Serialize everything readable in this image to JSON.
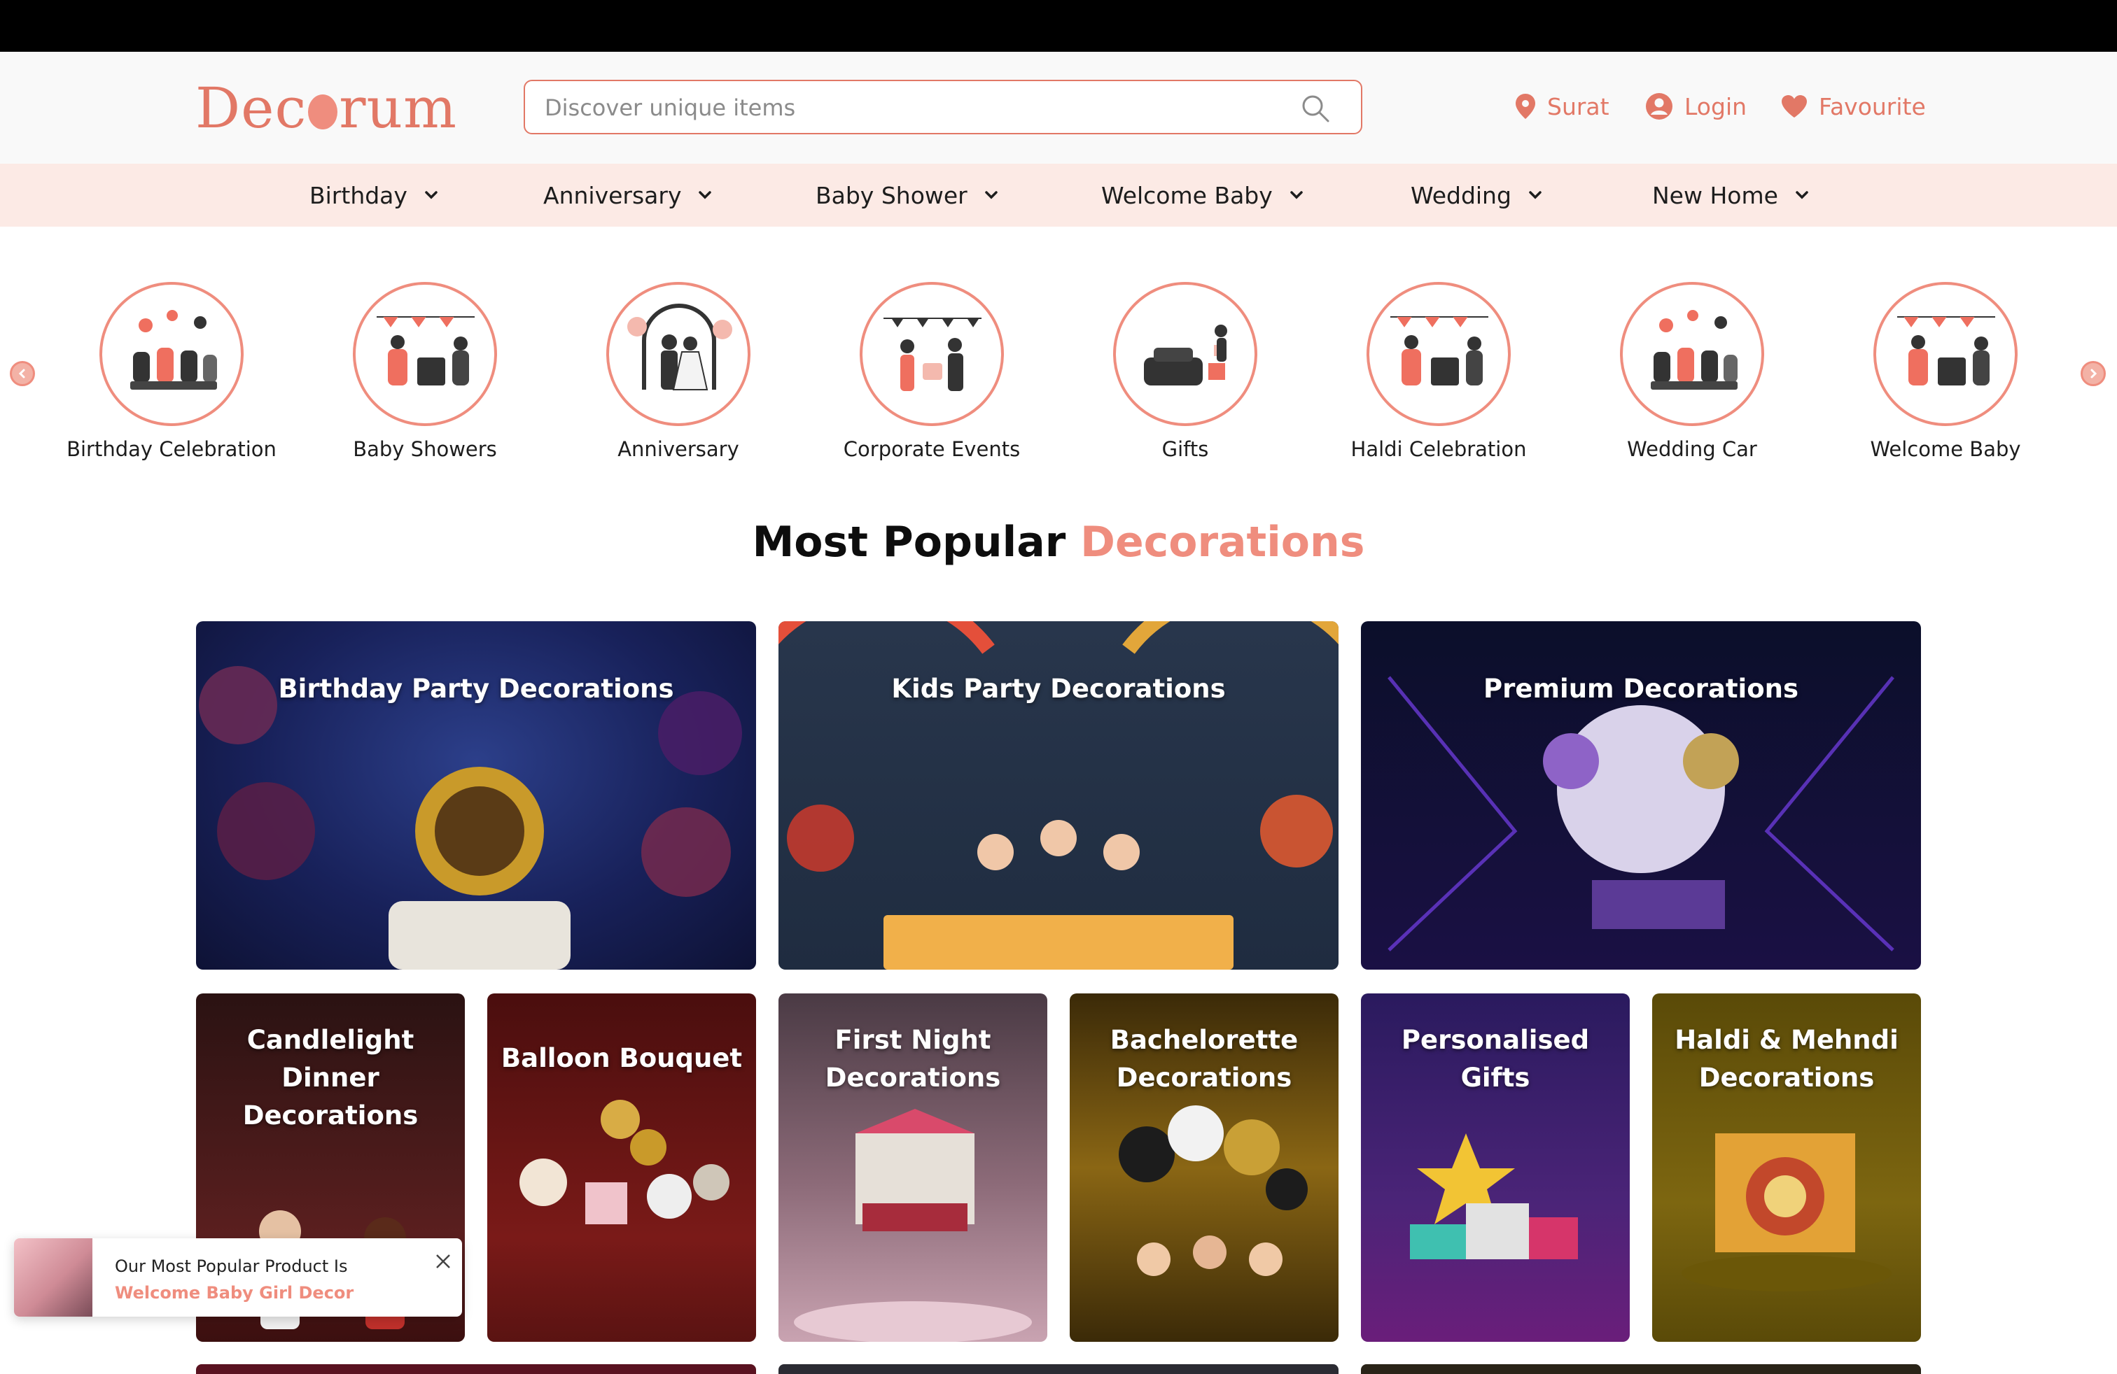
{
  "header": {
    "logo": {
      "pre": "Dec",
      "post": "rum"
    },
    "search_placeholder": "Discover unique items",
    "location": "Surat",
    "login": "Login",
    "favourite": "Favourite"
  },
  "nav": [
    "Birthday",
    "Anniversary",
    "Baby Shower",
    "Welcome Baby",
    "Wedding",
    "New Home"
  ],
  "categories": [
    "Birthday Celebration",
    "Baby Showers",
    "Anniversary",
    "Corporate Events",
    "Gifts",
    "Haldi Celebration",
    "Wedding Car",
    "Welcome Baby"
  ],
  "section": {
    "title": "Most Popular",
    "accent": "Decorations"
  },
  "cards_large": [
    "Birthday Party Decorations",
    "Kids Party Decorations",
    "Premium Decorations"
  ],
  "cards_small": [
    [
      "Candlelight Dinner",
      "Decorations"
    ],
    [
      "Balloon Bouquet"
    ],
    [
      "First Night",
      "Decorations"
    ],
    [
      "Bachelorette",
      "Decorations"
    ],
    [
      "Personalised",
      "Gifts"
    ],
    [
      "Haldi & Mehndi",
      "Decorations"
    ]
  ],
  "toast": {
    "line1": "Our Most Popular Product Is",
    "line2": "Welcome Baby Girl Decor"
  },
  "colors": {
    "accent": "#ef8d7e",
    "logo": "#e27866",
    "nav_bg": "#fceae5"
  }
}
